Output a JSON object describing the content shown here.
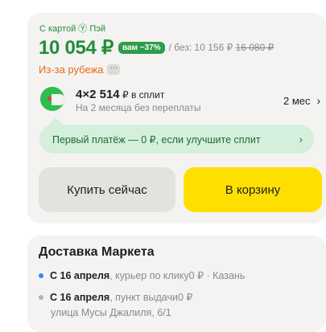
{
  "price_block": {
    "pay_caption": "С картой Ⓨ Пэй",
    "price": "10 054 ₽",
    "discount_badge": "вам −37%",
    "old_price_prefix": "/ без: 10 156 ₽",
    "old_price_crossed": "16 080 ₽",
    "origin_label": "Из-за рубежа",
    "origin_more": "···"
  },
  "split": {
    "amount": "4×2 514",
    "amount_suffix": " ₽ в сплит",
    "subtitle": "На 2 месяца без переплаты",
    "term": "2 мес",
    "term_chevron": "›"
  },
  "promo": {
    "text": "Первый платёж — 0 ₽, если улучшите сплит",
    "chevron": "›"
  },
  "actions": {
    "buy_now": "Купить сейчас",
    "add_to_cart": "В корзину",
    "cart_color": "#ffdf01"
  },
  "delivery": {
    "title": "Доставка Маркета",
    "courier": {
      "date": "С 16 апреля",
      "details": ", курьер по клику",
      "price": " 0 ₽ · Казань",
      "bullet_color": "#2b8cf0"
    },
    "pickup": {
      "date": "С 16 апреля",
      "details": ", пункт выдачи",
      "price": " 0 ₽",
      "address": "улица Мусы Джалиля, 6/1",
      "bullet_color": "#b5b5b5"
    }
  },
  "colors": {
    "accent_green": "#1f8f3a",
    "warning_orange": "#e86b12"
  }
}
